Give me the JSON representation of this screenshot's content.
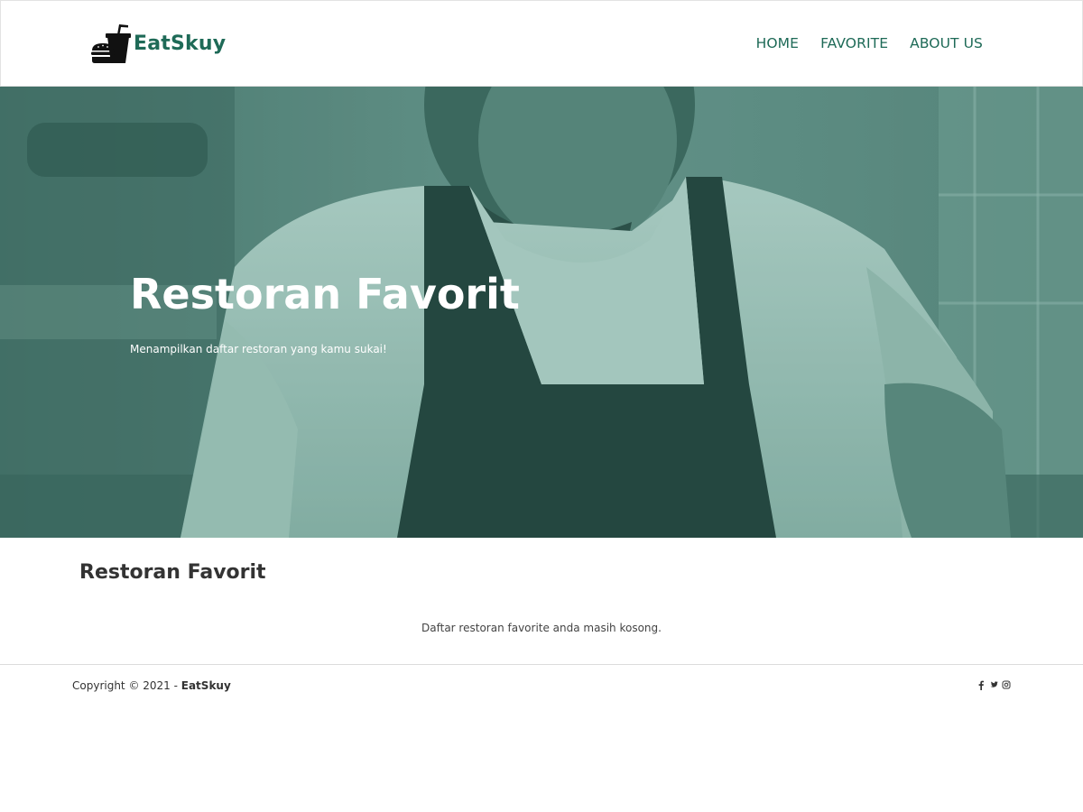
{
  "header": {
    "brand_name": "EatSkuy",
    "brand_icon": "fast-food-icon",
    "nav": [
      {
        "label": "HOME"
      },
      {
        "label": "FAVORITE"
      },
      {
        "label": "ABOUT US"
      }
    ]
  },
  "hero": {
    "title": "Restoran Favorit",
    "subtitle": "Menampilkan daftar restoran yang kamu sukai!"
  },
  "main": {
    "section_title": "Restoran Favorit",
    "empty_message": "Daftar restoran favorite anda masih kosong."
  },
  "footer": {
    "copyright_prefix": "Copyright © 2021 - ",
    "copyright_brand": "EatSkuy",
    "social_icons": [
      "facebook-icon",
      "twitter-icon",
      "instagram-icon"
    ]
  },
  "colors": {
    "brand": "#1e6a57",
    "hero_overlay": "#5f8f86",
    "text": "#333333"
  }
}
